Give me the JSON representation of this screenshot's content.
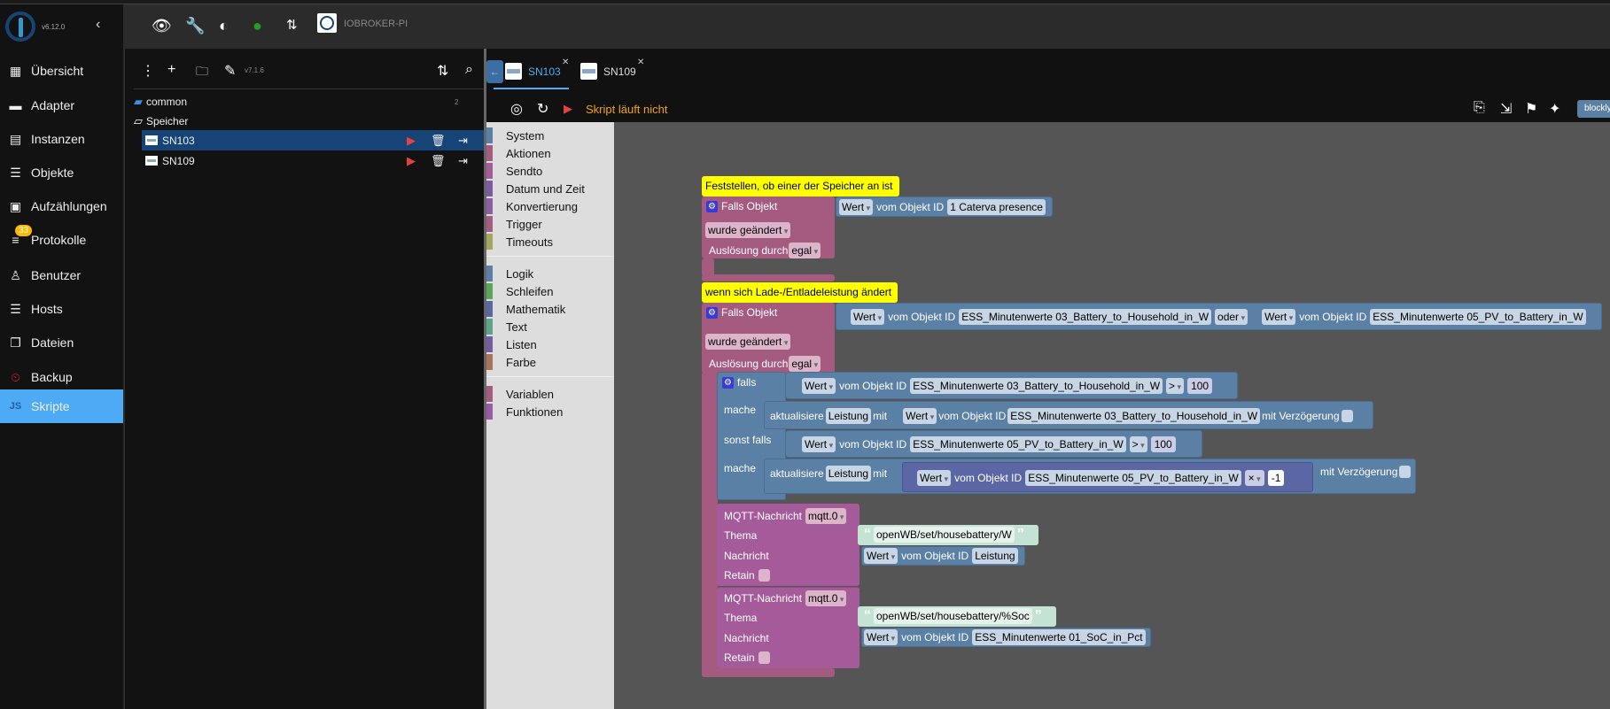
{
  "app": {
    "version": "v6.12.0",
    "host": "IOBROKER-PI"
  },
  "sidebar": {
    "items": [
      {
        "label": "Übersicht",
        "icon": "grid-icon"
      },
      {
        "label": "Adapter",
        "icon": "store-icon"
      },
      {
        "label": "Instanzen",
        "icon": "instances-icon"
      },
      {
        "label": "Objekte",
        "icon": "list-icon"
      },
      {
        "label": "Aufzählungen",
        "icon": "enum-icon"
      },
      {
        "label": "Protokolle",
        "icon": "log-icon",
        "badge": "33"
      },
      {
        "label": "Benutzer",
        "icon": "user-icon"
      },
      {
        "label": "Hosts",
        "icon": "hosts-icon"
      },
      {
        "label": "Dateien",
        "icon": "files-icon"
      },
      {
        "label": "Backup",
        "icon": "backup-icon"
      },
      {
        "label": "Skripte",
        "icon": "js-icon",
        "active": true
      }
    ]
  },
  "scripts": {
    "version": "v7.1.6",
    "tree": {
      "common": "common",
      "folder": "Speicher",
      "folder_count": "2",
      "items": [
        "SN103",
        "SN109"
      ]
    }
  },
  "tabs": [
    {
      "label": "SN103",
      "active": true
    },
    {
      "label": "SN109"
    }
  ],
  "editor": {
    "status": "Skript läuft nicht",
    "mode_badge": "blockly",
    "status_color": "#f0a30a"
  },
  "toolbox": {
    "groups": [
      [
        "System",
        "Aktionen",
        "Sendto",
        "Datum und Zeit",
        "Konvertierung",
        "Trigger",
        "Timeouts"
      ],
      [
        "Logik",
        "Schleifen",
        "Mathematik",
        "Text",
        "Listen",
        "Farbe"
      ],
      [
        "Variablen",
        "Funktionen"
      ]
    ],
    "colors": [
      [
        "#5b80a5",
        "#a55b80",
        "#a55b99",
        "#7b5ba5",
        "#8e5ba5",
        "#a55b80",
        "#a5a55b"
      ],
      [
        "#5b80a5",
        "#5ba55b",
        "#5b67a5",
        "#5ba58c",
        "#745ba5",
        "#a5745b"
      ],
      [
        "#a55b80",
        "#995ba5"
      ]
    ]
  },
  "blocks": {
    "comment1": "Feststellen, ob einer der Speicher an ist",
    "comment2": "wenn sich Lade-/Entladeleistung ändert",
    "falls_objekt": "Falls Objekt",
    "wurde": "wurde geändert",
    "ausloesung": "Auslösung durch",
    "egal": "egal",
    "wert": "Wert",
    "vom": "vom Objekt ID",
    "oder": "oder",
    "id_presence": "1 Caterva presence",
    "id_bat": "ESS_Minutenwerte 03_Battery_to_Household_in_W",
    "id_pv": "ESS_Minutenwerte 05_PV_to_Battery_in_W",
    "id_soc": "ESS_Minutenwerte 01_SoC_in_Pct",
    "falls": "falls",
    "mache": "mache",
    "sonst_falls": "sonst falls",
    "gt": ">",
    "hundred": "100",
    "times": "×",
    "minus1": "-1",
    "aktualisiere": "aktualisiere",
    "leistung": "Leistung",
    "mit": "mit",
    "verz": "mit Verzögerung",
    "mqtt": "MQTT-Nachricht",
    "mqtt_inst": "mqtt.0",
    "thema": "Thema",
    "nachricht": "Nachricht",
    "retain": "Retain",
    "topic1": "openWB/set/housebattery/W",
    "topic2": "openWB/set/housebattery/%Soc"
  }
}
